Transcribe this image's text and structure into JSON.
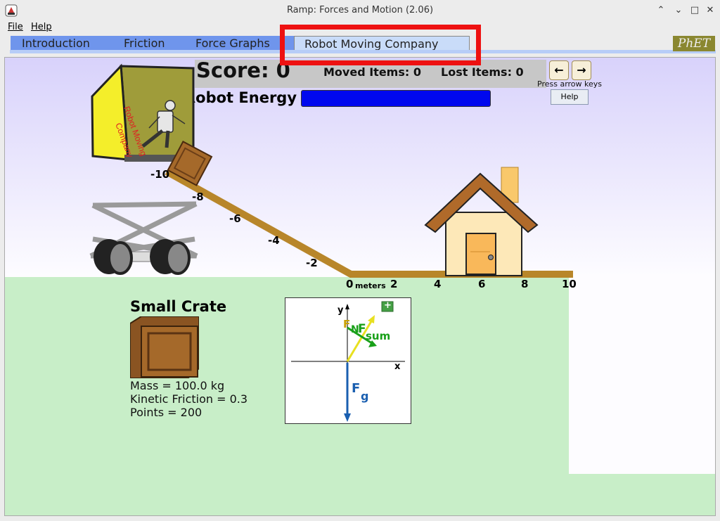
{
  "window": {
    "title": "Ramp: Forces and Motion (2.06)"
  },
  "menu": {
    "file": "File",
    "help": "Help"
  },
  "tabs": [
    {
      "label": "Introduction",
      "selected": false
    },
    {
      "label": "Friction",
      "selected": false
    },
    {
      "label": "Force Graphs",
      "selected": false
    },
    {
      "label": "Robot Moving Company",
      "selected": true
    }
  ],
  "logo": "PhET",
  "game": {
    "score_label": "Score: 0",
    "moved_items": "Moved Items: 0",
    "lost_items": "Lost Items: 0",
    "energy_label": "Robot Energy",
    "energy_fraction": 1.0,
    "press_arrow": "Press arrow keys",
    "help": "Help",
    "truck_text_1": "Robot Moving",
    "truck_text_2": "Company"
  },
  "ramp": {
    "ticks_left": [
      "-10",
      "-8",
      "-6",
      "-4",
      "-2"
    ],
    "ticks_right": [
      "0",
      "2",
      "4",
      "6",
      "8",
      "10"
    ],
    "unit": "meters"
  },
  "item": {
    "name": "Small Crate",
    "mass": "Mass = 100.0 kg",
    "friction": "Kinetic Friction = 0.3",
    "points": "Points = 200"
  },
  "fbd": {
    "y": "y",
    "x": "x",
    "plus": "+",
    "fn": "F",
    "fsum": "F",
    "fsum_sub": "sum",
    "fg": "F",
    "fg_sub": "g",
    "fn_n": "N"
  },
  "colors": {
    "highlight": "#ee1111",
    "energy": "#0008ee",
    "tab_active": "#c9dcf9",
    "tab": "#6f95ec",
    "ground": "#c8eec8"
  }
}
